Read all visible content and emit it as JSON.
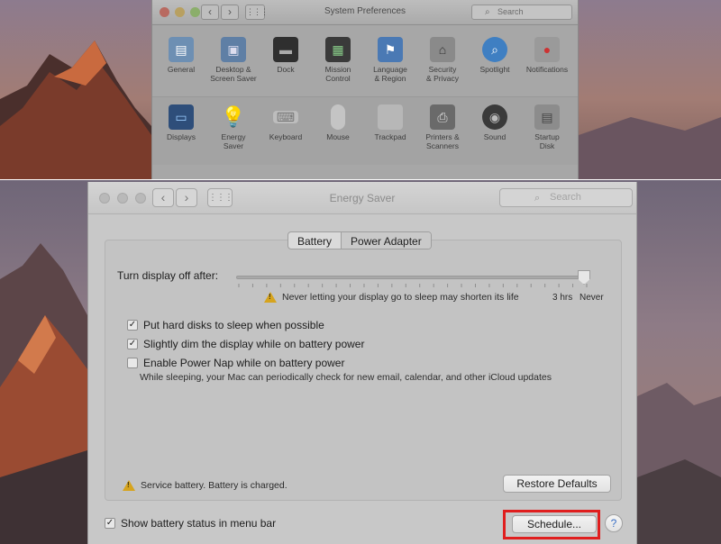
{
  "colors": {
    "highlight": "#e01e1e",
    "warning": "#d6a41e",
    "help_accent": "#3a6fc5"
  },
  "system_preferences": {
    "title": "System Preferences",
    "search_placeholder": "Search",
    "row1": [
      {
        "label": "General",
        "icon": "general-icon"
      },
      {
        "label": "Desktop &\nScreen Saver",
        "icon": "desktop-icon"
      },
      {
        "label": "Dock",
        "icon": "dock-icon"
      },
      {
        "label": "Mission\nControl",
        "icon": "mission-control-icon"
      },
      {
        "label": "Language\n& Region",
        "icon": "language-icon"
      },
      {
        "label": "Security\n& Privacy",
        "icon": "security-icon"
      },
      {
        "label": "Spotlight",
        "icon": "spotlight-icon"
      },
      {
        "label": "Notifications",
        "icon": "notifications-icon"
      }
    ],
    "row2": [
      {
        "label": "Displays",
        "icon": "displays-icon"
      },
      {
        "label": "Energy\nSaver",
        "icon": "energy-saver-icon"
      },
      {
        "label": "Keyboard",
        "icon": "keyboard-icon"
      },
      {
        "label": "Mouse",
        "icon": "mouse-icon"
      },
      {
        "label": "Trackpad",
        "icon": "trackpad-icon"
      },
      {
        "label": "Printers &\nScanners",
        "icon": "printer-icon"
      },
      {
        "label": "Sound",
        "icon": "sound-icon"
      },
      {
        "label": "Startup\nDisk",
        "icon": "startup-disk-icon"
      }
    ]
  },
  "energy_saver": {
    "title": "Energy Saver",
    "search_placeholder": "Search",
    "tabs": [
      "Battery",
      "Power Adapter"
    ],
    "active_tab": "Power Adapter",
    "slider_label": "Turn display off after:",
    "slider_value": "Never",
    "warning_text": "Never letting your display go to sleep may shorten its life",
    "tick_3hrs": "3 hrs",
    "tick_never": "Never",
    "options": [
      {
        "label": "Put hard disks to sleep when possible",
        "checked": true
      },
      {
        "label": "Slightly dim the display while on battery power",
        "checked": true
      },
      {
        "label": "Enable Power Nap while on battery power",
        "checked": false
      }
    ],
    "power_nap_subtext": "While sleeping, your Mac can periodically check for new email, calendar, and other iCloud updates",
    "service_text": "Service battery. Battery is charged.",
    "restore_label": "Restore Defaults",
    "show_status_label": "Show battery status in menu bar",
    "show_status_checked": true,
    "schedule_label": "Schedule...",
    "help_label": "?"
  }
}
